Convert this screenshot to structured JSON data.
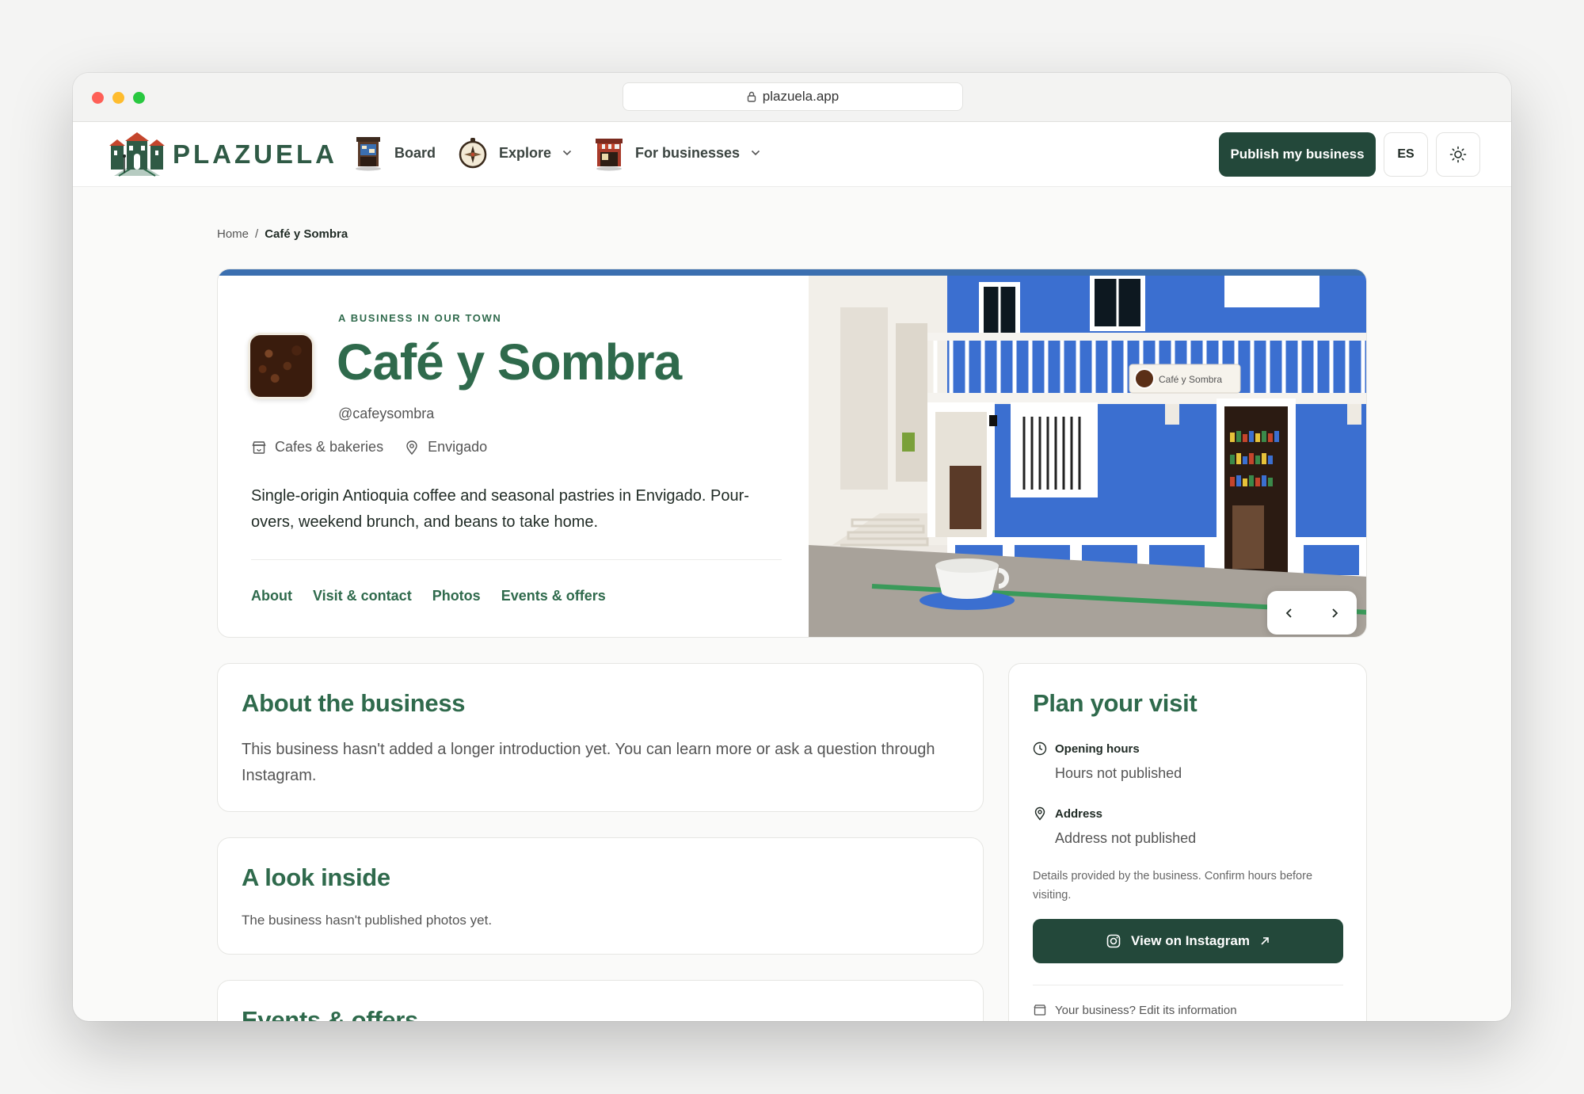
{
  "browser": {
    "url": "plazuela.app"
  },
  "nav": {
    "logo_text": "PLAZUELA",
    "items": [
      {
        "label": "Board"
      },
      {
        "label": "Explore"
      },
      {
        "label": "For businesses"
      }
    ],
    "publish_label": "Publish my business",
    "lang_label": "ES"
  },
  "breadcrumb": {
    "home": "Home",
    "separator": "/",
    "current": "Café y Sombra"
  },
  "hero": {
    "eyebrow": "A BUSINESS IN OUR TOWN",
    "name": "Café y Sombra",
    "handle": "@cafeysombra",
    "category": "Cafes & bakeries",
    "location": "Envigado",
    "description": "Single-origin Antioquia coffee and seasonal pastries in Envigado. Pour-overs, weekend brunch, and beans to take home.",
    "tabs": [
      "About",
      "Visit & contact",
      "Photos",
      "Events & offers"
    ],
    "sign_text": "Café y Sombra"
  },
  "about": {
    "title": "About the business",
    "text": "This business hasn't added a longer introduction yet. You can learn more or ask a question through Instagram."
  },
  "look": {
    "title": "A look inside",
    "text": "The business hasn't published photos yet."
  },
  "events": {
    "title": "Events & offers"
  },
  "plan": {
    "title": "Plan your visit",
    "hours_label": "Opening hours",
    "hours_value": "Hours not published",
    "address_label": "Address",
    "address_value": "Address not published",
    "note": "Details provided by the business. Confirm hours before visiting.",
    "instagram_label": "View on Instagram",
    "footer_text": "Your business? Edit its information"
  },
  "colors": {
    "brand_green": "#2f6a4c",
    "button_dark": "#23483a",
    "facade_blue": "#3b6fd0"
  }
}
